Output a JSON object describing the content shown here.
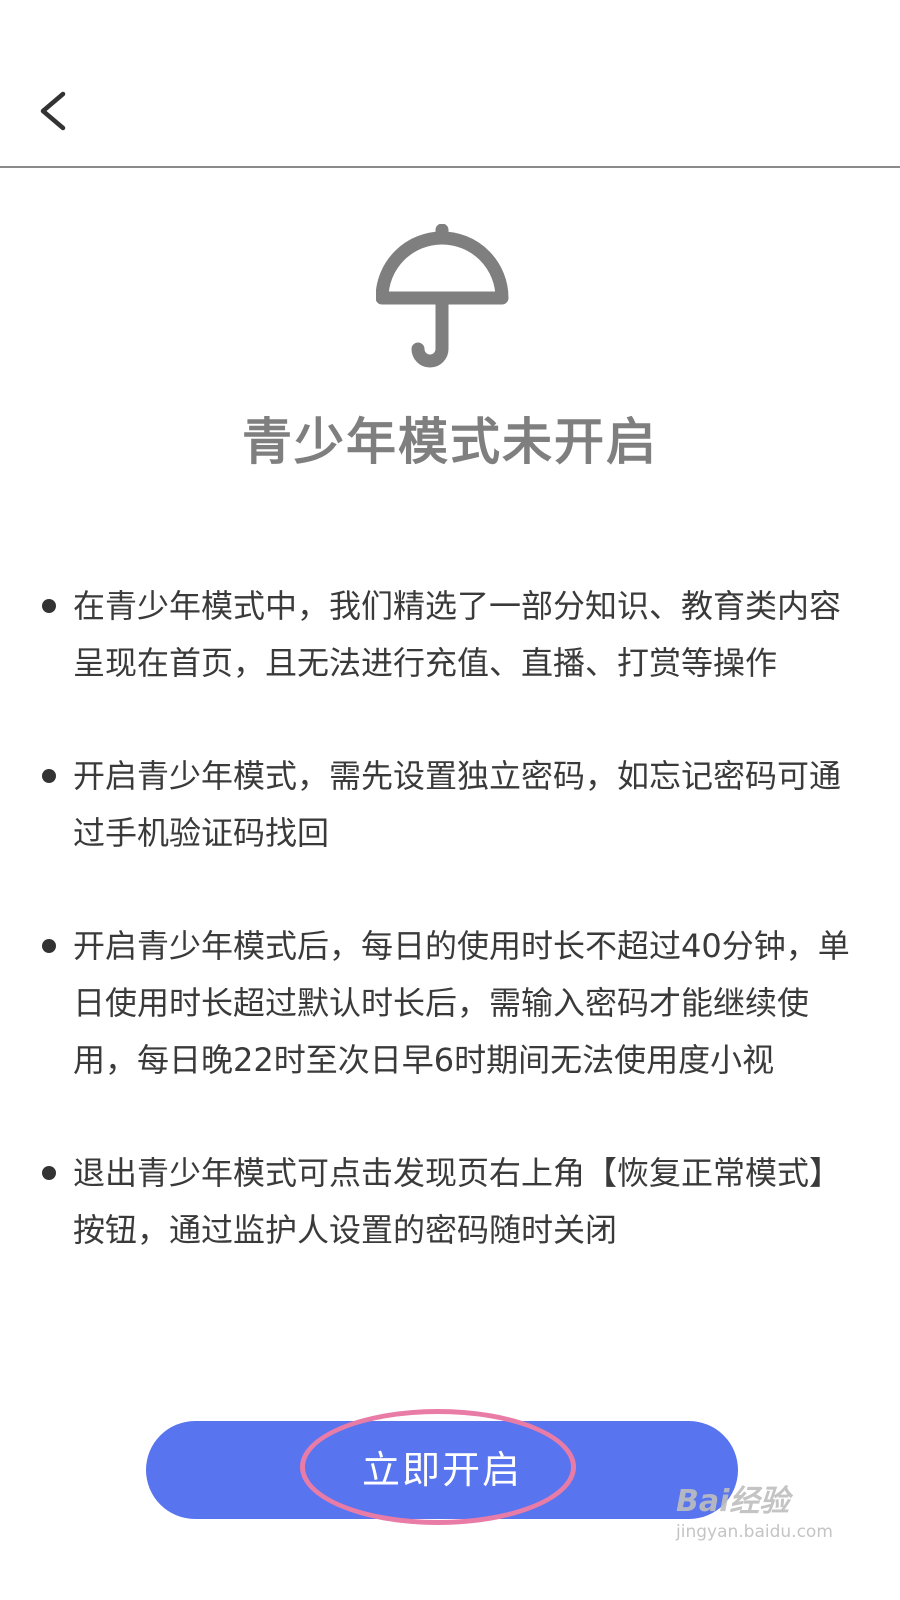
{
  "header": {
    "back_icon": "chevron-left-icon"
  },
  "hero": {
    "icon": "umbrella-icon",
    "title": "青少年模式未开启"
  },
  "rules": [
    "在青少年模式中，我们精选了一部分知识、教育类内容呈现在首页，且无法进行充值、直播、打赏等操作",
    "开启青少年模式，需先设置独立密码，如忘记密码可通过手机验证码找回",
    "开启青少年模式后，每日的使用时长不超过40分钟，单日使用时长超过默认时长后，需输入密码才能继续使用，每日晚22时至次日早6时期间无法使用度小视",
    "退出青少年模式可点击发现页右上角【恢复正常模式】按钮，通过监护人设置的密码随时关闭"
  ],
  "action": {
    "open_label": "立即开启"
  },
  "watermark": {
    "logo": "Bai经验",
    "url": "jingyan.baidu.com"
  },
  "colors": {
    "button": "#5874ef",
    "highlight": "#e97ca6",
    "title": "#7f7f7f",
    "icon": "#7f7f7f"
  }
}
